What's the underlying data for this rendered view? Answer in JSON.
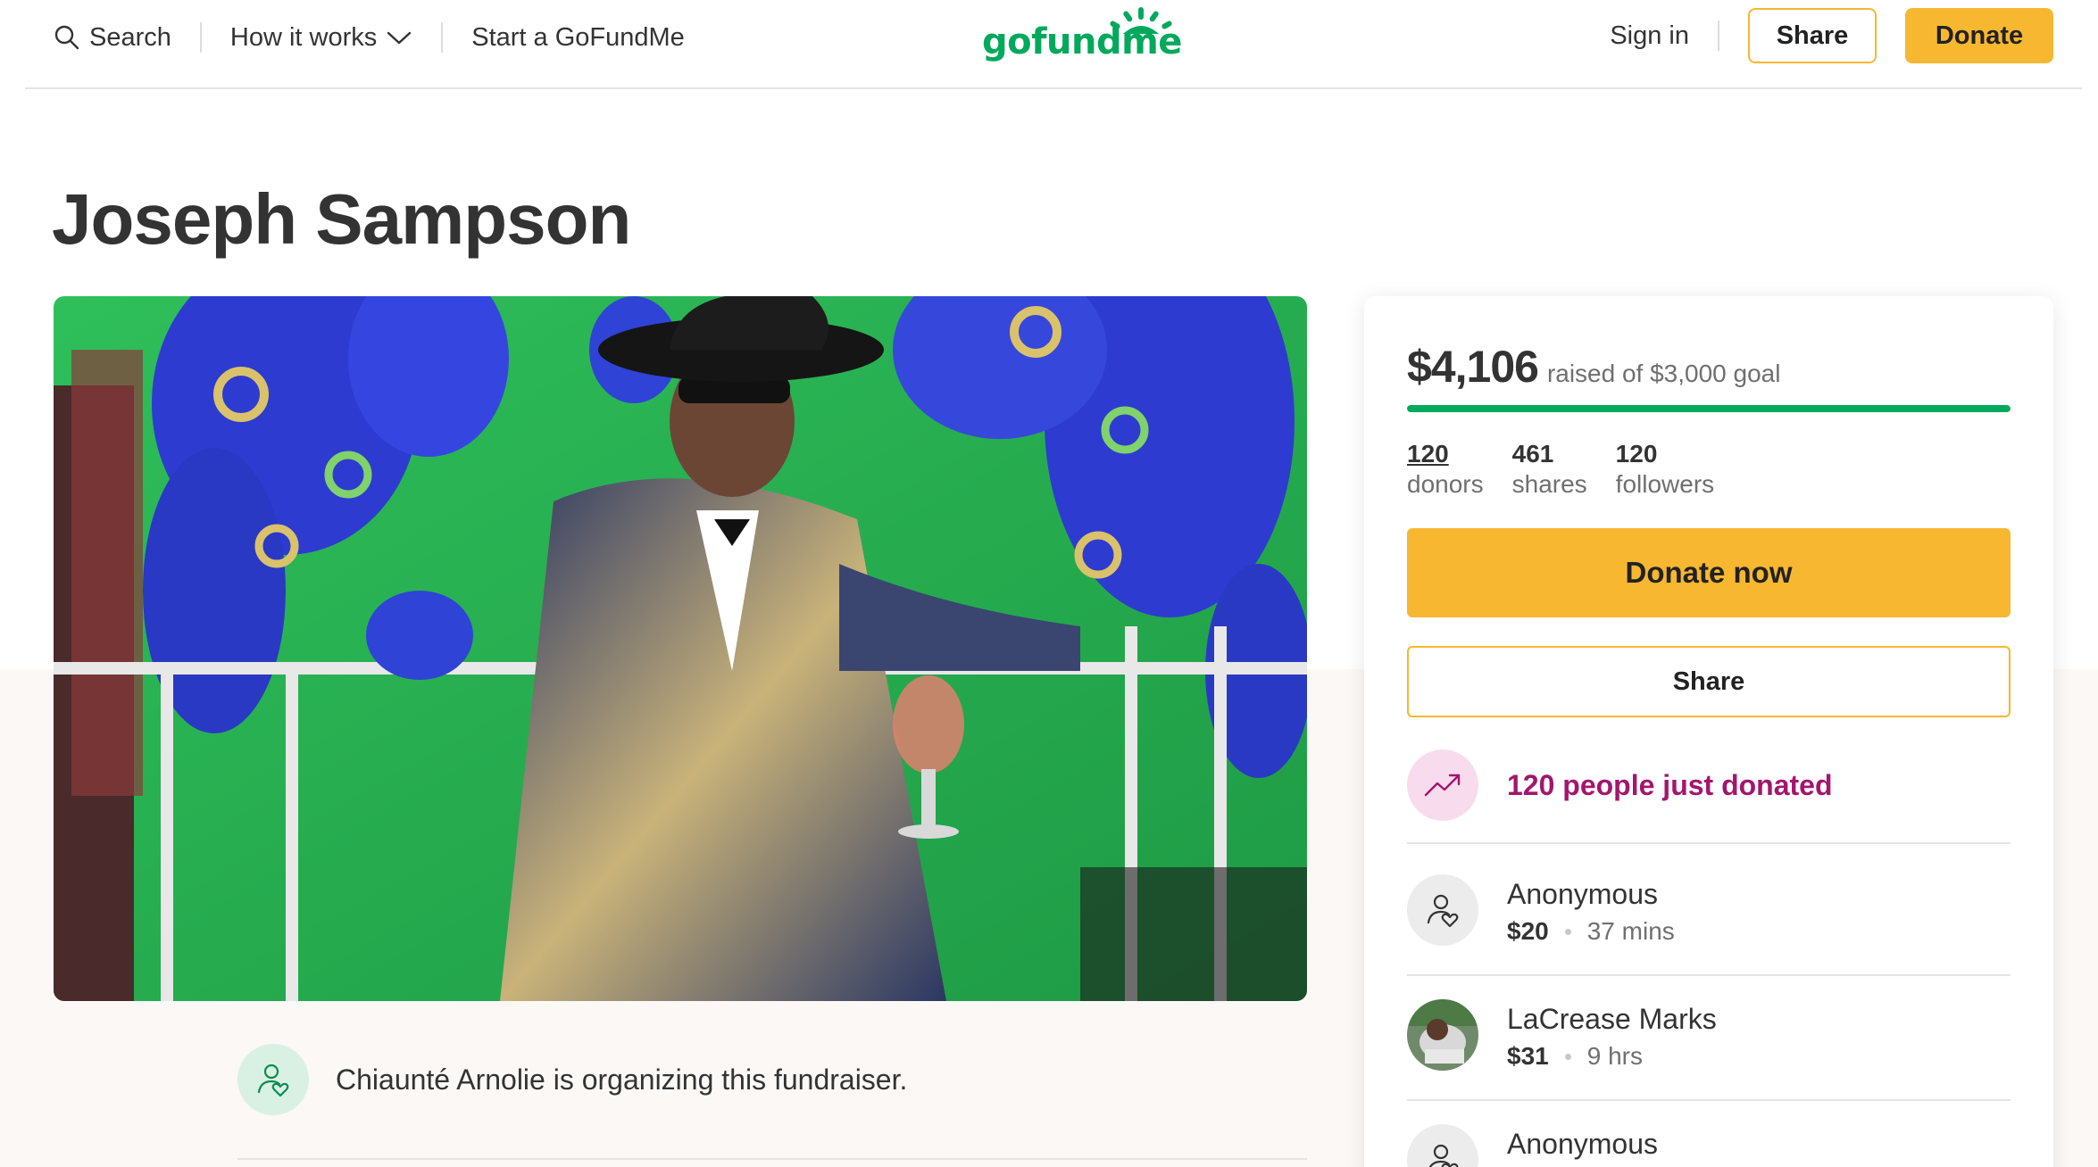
{
  "header": {
    "search_label": "Search",
    "how_it_works_label": "How it works",
    "start_label": "Start a GoFundMe",
    "logo_text": "gofundme",
    "signin_label": "Sign in",
    "share_label": "Share",
    "donate_label": "Donate"
  },
  "campaign": {
    "title": "Joseph Sampson",
    "organizer_text": "Chiaunté Arnolie is organizing this fundraiser."
  },
  "card": {
    "raised": "$4,106",
    "goal_text": "raised of $3,000 goal",
    "progress_fraction": 1.0,
    "stats": [
      {
        "value": "120",
        "label": "donors"
      },
      {
        "value": "461",
        "label": "shares"
      },
      {
        "value": "120",
        "label": "followers"
      }
    ],
    "donate_now_label": "Donate now",
    "share_label": "Share",
    "trend_text": "120 people just donated",
    "donations": [
      {
        "name": "Anonymous",
        "amount": "$20",
        "time": "37 mins"
      },
      {
        "name": "LaCrease Marks",
        "amount": "$31",
        "time": "9 hrs"
      },
      {
        "name": "Anonymous",
        "amount": "",
        "time": ""
      }
    ]
  },
  "colors": {
    "brand_green": "#02a95c",
    "button_yellow": "#f7b731",
    "trend_magenta": "#a3166d"
  }
}
